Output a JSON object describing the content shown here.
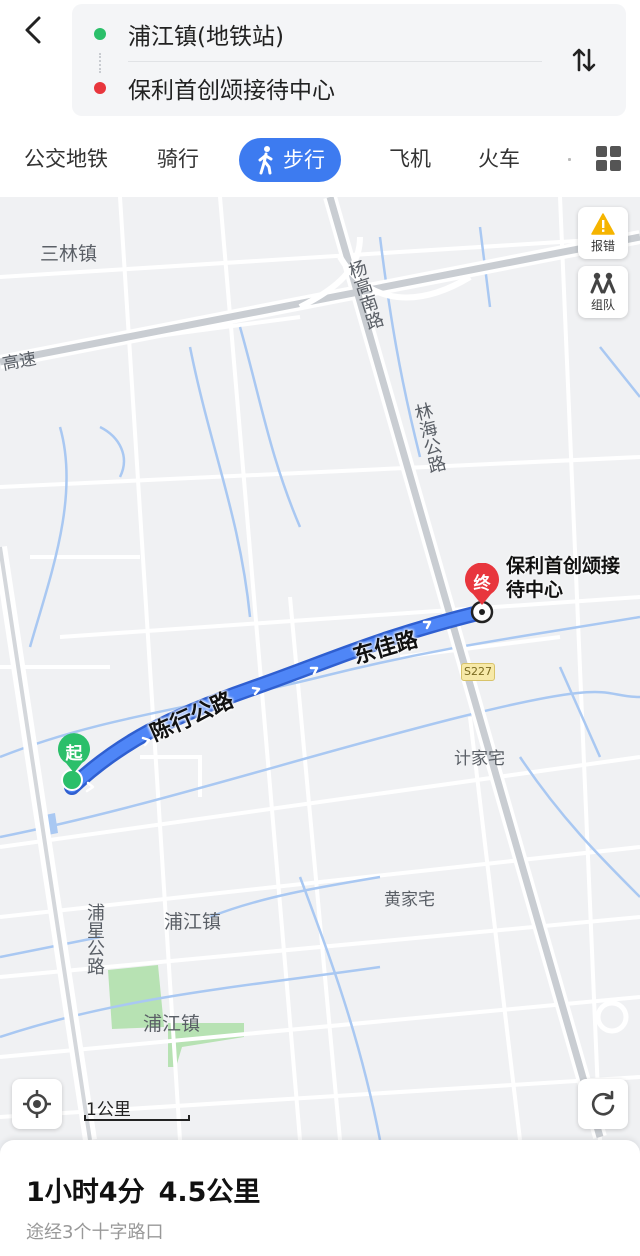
{
  "header": {
    "origin": "浦江镇(地铁站)",
    "destination": "保利首创颂接待中心",
    "origin_color": "#2bbf6a",
    "destination_color": "#e8363d"
  },
  "tabs": [
    {
      "label": "公交地铁",
      "active": false
    },
    {
      "label": "骑行",
      "active": false
    },
    {
      "label": "步行",
      "active": true
    },
    {
      "label": "飞机",
      "active": false
    },
    {
      "label": "火车",
      "active": false
    }
  ],
  "accent_color": "#3d7bf0",
  "map": {
    "labels": {
      "sanlin": "三林镇",
      "gaosu": "高速",
      "yanggao": "杨高南路",
      "linhai": "林海公路",
      "chenhang": "陈行公路",
      "dongjia": "东佳路",
      "s227": "S227",
      "jijiazhai": "计家宅",
      "huangjiazhai": "黄家宅",
      "pujiang1": "浦江镇",
      "pujiang2": "浦江镇",
      "puxing": "浦星公路"
    },
    "start_marker": "起",
    "end_marker": "终",
    "destination_name": "保利首创颂接待中心",
    "report_label": "报错",
    "team_label": "组队",
    "scale_label": "1公里"
  },
  "summary": {
    "duration": "1小时4分",
    "distance": "4.5公里",
    "detail": "途经3个十字路口"
  }
}
